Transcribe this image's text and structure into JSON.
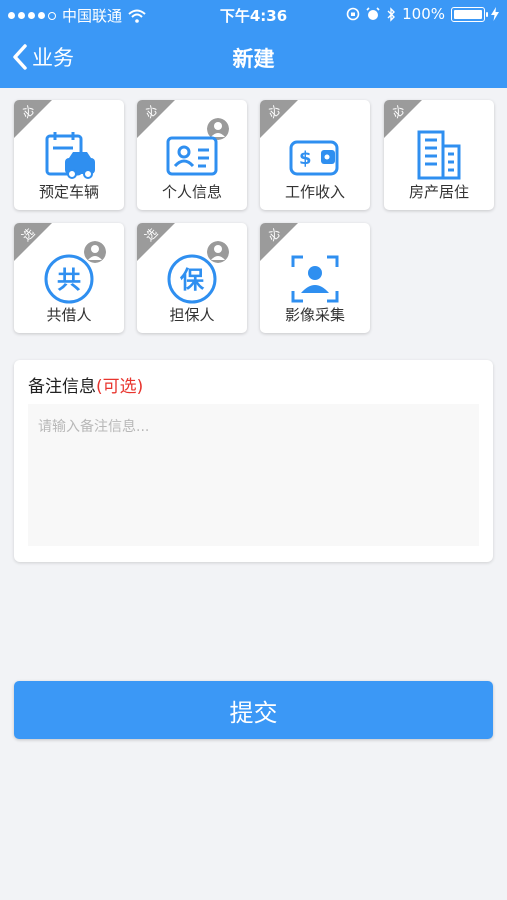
{
  "statusbar": {
    "carrier": "中国联通",
    "time": "下午4:36",
    "battery": "100%"
  },
  "nav": {
    "back_label": "业务",
    "title": "新建"
  },
  "tiles": [
    {
      "label": "预定车辆",
      "tag": "必",
      "icon": "car-calendar-icon",
      "person_badge": false
    },
    {
      "label": "个人信息",
      "tag": "必",
      "icon": "id-card-icon",
      "person_badge": true
    },
    {
      "label": "工作收入",
      "tag": "必",
      "icon": "wallet-icon",
      "person_badge": false
    },
    {
      "label": "房产居住",
      "tag": "必",
      "icon": "building-icon",
      "person_badge": false
    },
    {
      "label": "共借人",
      "tag": "选",
      "icon": "co-borrower-icon",
      "person_badge": true
    },
    {
      "label": "担保人",
      "tag": "选",
      "icon": "guarantor-icon",
      "person_badge": true
    },
    {
      "label": "影像采集",
      "tag": "必",
      "icon": "face-scan-icon",
      "person_badge": false
    }
  ],
  "notes": {
    "title": "备注信息",
    "optional": "(可选)",
    "placeholder": "请输入备注信息..."
  },
  "submit_label": "提交",
  "colors": {
    "primary": "#3b98f6",
    "ribbon": "#9b9b9b",
    "optional_text": "#e8352e"
  }
}
